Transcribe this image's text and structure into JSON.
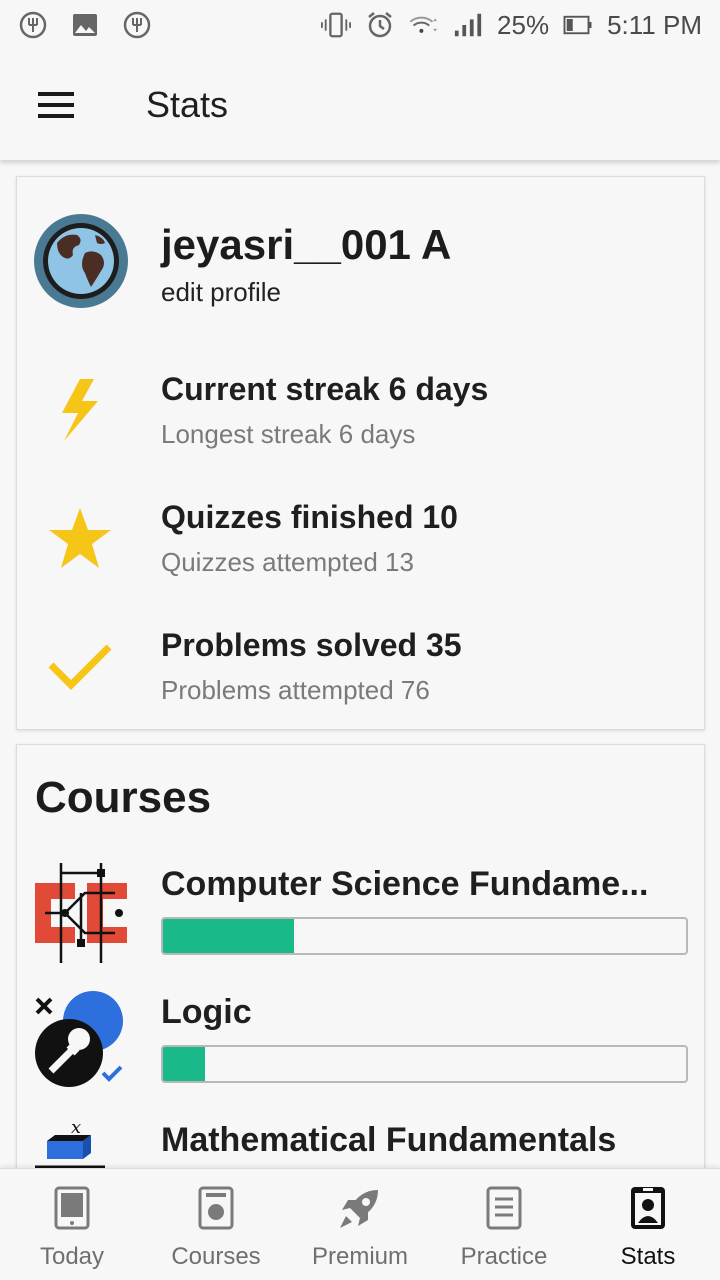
{
  "status_bar": {
    "battery": "25%",
    "time": "5:11 PM",
    "icons": [
      "fork-icon",
      "image-icon",
      "fork-icon",
      "vibrate-icon",
      "alarm-icon",
      "wifi-icon",
      "signal-icon",
      "battery-icon"
    ]
  },
  "app_bar": {
    "title": "Stats",
    "menu_icon": "hamburger-menu-icon"
  },
  "profile": {
    "username": "jeyasri__001 A",
    "edit_label": "edit profile",
    "avatar_icon": "globe-icon"
  },
  "stats": [
    {
      "icon": "lightning-icon",
      "main": "Current streak 6 days",
      "sub": "Longest streak 6 days"
    },
    {
      "icon": "star-icon",
      "main": "Quizzes finished 10",
      "sub": "Quizzes attempted 13"
    },
    {
      "icon": "check-icon",
      "main": "Problems solved 35",
      "sub": "Problems attempted 76"
    }
  ],
  "courses": {
    "title": "Courses",
    "items": [
      {
        "name": "Computer Science Fundame...",
        "progress": 0.25,
        "icon": "circuit-icon"
      },
      {
        "name": "Logic",
        "progress": 0.08,
        "icon": "logic-icon"
      },
      {
        "name": "Mathematical Fundamentals",
        "progress": null,
        "icon": "math-blocks-icon"
      }
    ]
  },
  "bottom_nav": [
    {
      "label": "Today",
      "icon": "tablet-icon",
      "active": false
    },
    {
      "label": "Courses",
      "icon": "course-card-icon",
      "active": false
    },
    {
      "label": "Premium",
      "icon": "rocket-icon",
      "active": false
    },
    {
      "label": "Practice",
      "icon": "document-icon",
      "active": false
    },
    {
      "label": "Stats",
      "icon": "profile-badge-icon",
      "active": true
    }
  ],
  "colors": {
    "accent_yellow": "#f5c518",
    "progress_green": "#19b98a",
    "background": "#f7f7f7"
  }
}
